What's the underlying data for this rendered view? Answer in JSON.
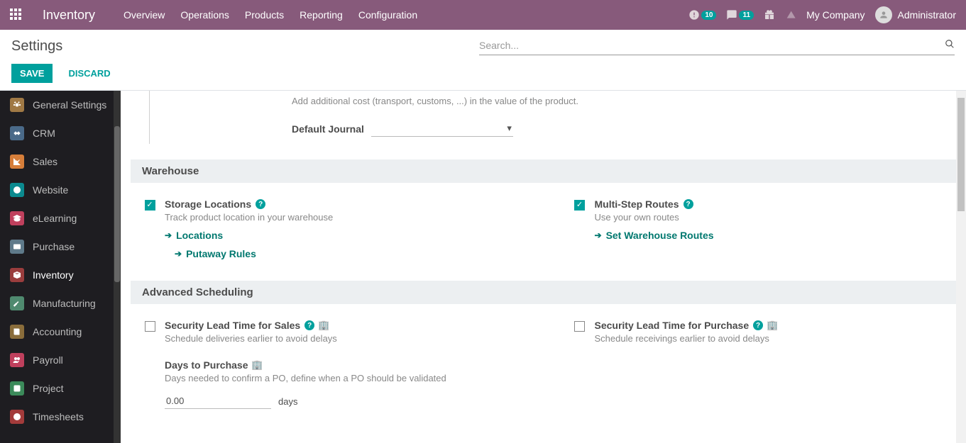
{
  "topbar": {
    "app": "Inventory",
    "menu": [
      "Overview",
      "Operations",
      "Products",
      "Reporting",
      "Configuration"
    ],
    "activities_count": "10",
    "messages_count": "11",
    "company": "My Company",
    "user": "Administrator"
  },
  "header": {
    "title": "Settings",
    "search_placeholder": "Search...",
    "save": "SAVE",
    "discard": "DISCARD"
  },
  "sidebar": [
    {
      "label": "General Settings",
      "icon": "gear",
      "color": "#a07945"
    },
    {
      "label": "CRM",
      "icon": "hands",
      "color": "#4a6a89"
    },
    {
      "label": "Sales",
      "icon": "chart",
      "color": "#d67e3a"
    },
    {
      "label": "Website",
      "icon": "globe",
      "color": "#0b8a8f"
    },
    {
      "label": "eLearning",
      "icon": "grad",
      "color": "#bf405d"
    },
    {
      "label": "Purchase",
      "icon": "card",
      "color": "#5f7a8a"
    },
    {
      "label": "Inventory",
      "icon": "box",
      "color": "#9a3d3d",
      "active": true
    },
    {
      "label": "Manufacturing",
      "icon": "wrench",
      "color": "#4f8a6f"
    },
    {
      "label": "Accounting",
      "icon": "book",
      "color": "#8a6d3b"
    },
    {
      "label": "Payroll",
      "icon": "users",
      "color": "#bf405d"
    },
    {
      "label": "Project",
      "icon": "check",
      "color": "#3b8a5a"
    },
    {
      "label": "Timesheets",
      "icon": "clock",
      "color": "#a33b3b"
    }
  ],
  "landed": {
    "desc": "Add additional cost (transport, customs, ...) in the value of the product.",
    "label": "Default Journal"
  },
  "sections": {
    "warehouse": {
      "title": "Warehouse",
      "storage": {
        "title": "Storage Locations",
        "desc": "Track product location in your warehouse",
        "link1": "Locations",
        "link2": "Putaway Rules",
        "checked": true
      },
      "routes": {
        "title": "Multi-Step Routes",
        "desc": "Use your own routes",
        "link1": "Set Warehouse Routes",
        "checked": true
      }
    },
    "scheduling": {
      "title": "Advanced Scheduling",
      "sec_sales": {
        "title": "Security Lead Time for Sales",
        "desc": "Schedule deliveries earlier to avoid delays",
        "checked": false
      },
      "sec_purchase": {
        "title": "Security Lead Time for Purchase",
        "desc": "Schedule receivings earlier to avoid delays",
        "checked": false
      },
      "days": {
        "title": "Days to Purchase",
        "desc": "Days needed to confirm a PO, define when a PO should be validated",
        "value": "0.00",
        "unit": "days"
      }
    }
  }
}
